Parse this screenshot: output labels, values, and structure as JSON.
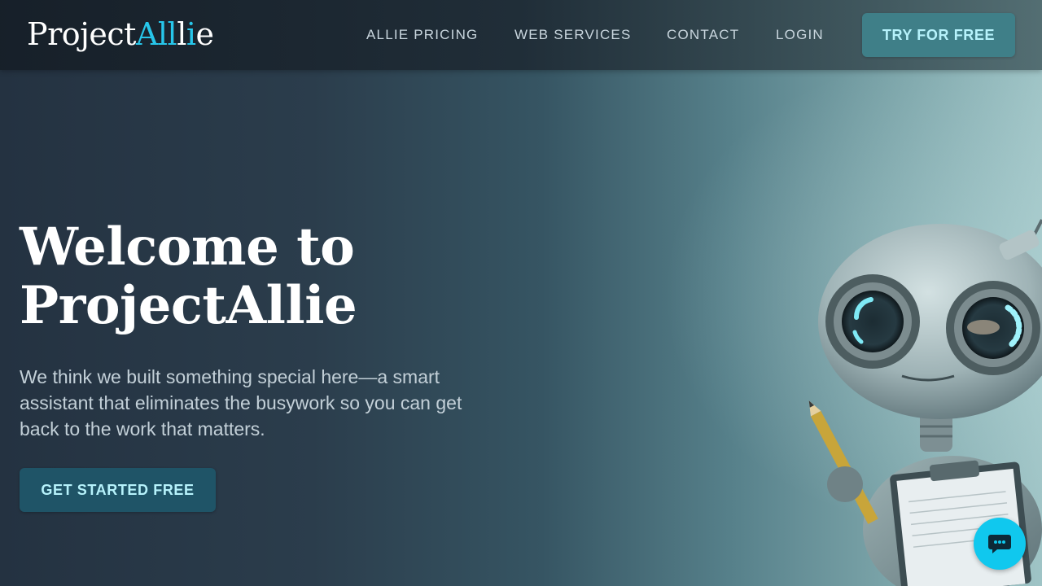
{
  "brand": {
    "logo_main": "Project",
    "logo_accent_a": "All",
    "logo_accent_i": "i",
    "logo_rest_l": "l",
    "logo_rest_e": "e",
    "accent_color": "#27c6ea"
  },
  "nav": {
    "links": [
      {
        "label": "ALLIE PRICING"
      },
      {
        "label": "WEB SERVICES"
      },
      {
        "label": "CONTACT"
      },
      {
        "label": "LOGIN"
      }
    ],
    "cta_label": "TRY FOR FREE"
  },
  "hero": {
    "title_line1": "Welcome to",
    "title_line2": "ProjectAllie",
    "subtitle": "We think we built something special here—a smart assistant that eliminates the busywork so you can get back to the work that matters.",
    "cta_label": "GET STARTED FREE"
  },
  "chat": {
    "icon": "chat-bubble-icon",
    "color": "#10c8ee"
  },
  "illustration": {
    "icon": "robot-with-clipboard-and-pencil"
  }
}
